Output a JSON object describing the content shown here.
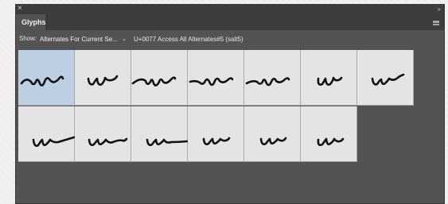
{
  "panel": {
    "close_glyph": "×",
    "collapse_glyph": "»",
    "tab_label": "Glyphs",
    "menu_icon": "panel-menu-icon"
  },
  "toolbar": {
    "show_label": "Show:",
    "show_value": "Alternates For Current Se...",
    "caret": "⌄",
    "info": "U+0077 Access All Alternates#5 (salt5)"
  },
  "glyphs": {
    "rows": [
      [
        "w swash alternate 1",
        "w alternate 2",
        "w swash alternate 3",
        "w swash alternate 4",
        "w swash alternate 5",
        "w alternate 6",
        "w alternate 7"
      ],
      [
        "w tail alternate 1",
        "w tail alternate 2",
        "w tail alternate 3",
        "w alternate 8",
        "w alternate 9",
        "w alternate 10"
      ]
    ],
    "selected_index": 0
  }
}
